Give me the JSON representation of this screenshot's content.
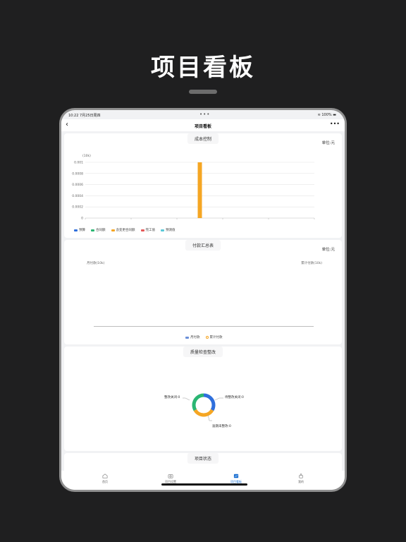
{
  "hero_title": "项目看板",
  "status": {
    "time": "10:22  7月25日周四",
    "battery": "100%"
  },
  "nav": {
    "title": "项目看板",
    "back": "‹",
    "more": "•••"
  },
  "cost_card": {
    "title": "成本控制",
    "unit": "单位:元",
    "ylabel": "(10k)",
    "legend": [
      {
        "label": "预算",
        "color": "#2f6fdc"
      },
      {
        "label": "合同额",
        "color": "#2bb673"
      },
      {
        "label": "含变更合同额",
        "color": "#f5a623"
      },
      {
        "label": "完工值",
        "color": "#e45858"
      },
      {
        "label": "预测值",
        "color": "#5ac8d8"
      }
    ]
  },
  "chart_data": {
    "type": "bar",
    "ylabel": "(10k)",
    "ylim": [
      0,
      0.001
    ],
    "yticks": [
      "0.001",
      "0.0008",
      "0.0006",
      "0.0004",
      "0.0002",
      "0"
    ],
    "series": [
      {
        "name": "预算",
        "values": [
          0
        ]
      },
      {
        "name": "合同额",
        "values": [
          0
        ]
      },
      {
        "name": "含变更合同额",
        "values": [
          0.001
        ]
      },
      {
        "name": "完工值",
        "values": [
          0
        ]
      },
      {
        "name": "预测值",
        "values": [
          0
        ]
      }
    ],
    "grid": true,
    "legend_placement": "bottom-left"
  },
  "payment_card": {
    "title": "付款汇总表",
    "unit": "单位:元",
    "left_axis": "月付款(10k)",
    "right_axis": "累计付款(10k)",
    "legend_bar": "月付款",
    "legend_line": "累计付款",
    "bar_color": "#6a8fd8",
    "line_color": "#f5a623"
  },
  "quality_card": {
    "title": "质量检查整改",
    "labels": {
      "closed": "整改关闭:0",
      "pending": "待整改关闭:0",
      "overdue": "逾期未整改:0"
    },
    "colors": {
      "blue": "#2f6fdc",
      "orange": "#f5a623",
      "green": "#2bb673"
    }
  },
  "status_card": {
    "title": "项目状态"
  },
  "tabs": [
    {
      "label": "首页"
    },
    {
      "label": "项目设置"
    },
    {
      "label": "项目看板"
    },
    {
      "label": "我的"
    }
  ]
}
